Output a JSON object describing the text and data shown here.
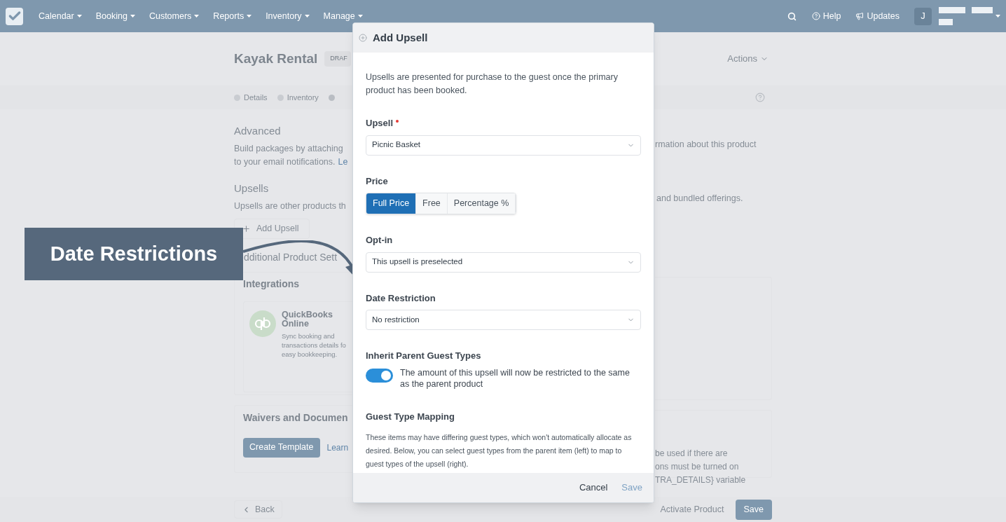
{
  "nav": {
    "items": [
      {
        "label": "Calendar"
      },
      {
        "label": "Booking"
      },
      {
        "label": "Customers"
      },
      {
        "label": "Reports"
      },
      {
        "label": "Inventory"
      },
      {
        "label": "Manage"
      }
    ],
    "help": "Help",
    "updates": "Updates",
    "avatar": "J"
  },
  "page": {
    "title": "Kayak Rental",
    "badge": "DRAF",
    "actions": "Actions",
    "steps": [
      {
        "label": "Details"
      },
      {
        "label": "Inventory"
      }
    ]
  },
  "advanced": {
    "heading": "Advanced",
    "text_left": [
      "Build packages by attaching",
      "to your email notifications."
    ],
    "link": "Le",
    "text_right": "rmation about this product"
  },
  "upsells": {
    "heading": "Upsells",
    "text_left": "Upsells are other products th",
    "text_right": "and bundled offerings.",
    "add_button": "Add Upsell"
  },
  "additional_heading": "dditional Product Sett",
  "integrations": {
    "title": "Integrations",
    "app_name": "QuickBooks Online",
    "app_description": [
      "Sync booking and",
      "transactions details fo",
      "easy bookkeeping."
    ]
  },
  "waivers": {
    "title": "Waivers and Documen",
    "button": "Create Template",
    "link": "Learn",
    "note_lines": [
      "be used if there are",
      "ons must be turned on",
      "TRA_DETAILS} variable"
    ]
  },
  "footer": {
    "back": "Back",
    "activate": "Activate Product",
    "save": "Save"
  },
  "callout": "Date Restrictions",
  "modal": {
    "title": "Add Upsell",
    "description": "Upsells are presented for purchase to the guest once the primary product has been booked.",
    "upsell": {
      "label": "Upsell",
      "required": true,
      "value": "Picnic Basket"
    },
    "price": {
      "label": "Price",
      "options": [
        {
          "label": "Full Price",
          "selected": true
        },
        {
          "label": "Free",
          "selected": false
        },
        {
          "label": "Percentage %",
          "selected": false
        }
      ]
    },
    "opt_in": {
      "label": "Opt-in",
      "value": "This upsell is preselected"
    },
    "date_restriction": {
      "label": "Date Restriction",
      "value": "No restriction"
    },
    "inherit": {
      "label": "Inherit Parent Guest Types",
      "on": true,
      "text": "The amount of this upsell will now be restricted to the same as the parent product"
    },
    "mapping": {
      "title": "Guest Type Mapping",
      "text": "These items may have differing guest types, which won't automatically allocate as desired. Below, you can select guest types from the parent item (left) to map to guest types of the upsell (right)."
    },
    "cancel": "Cancel",
    "save": {
      "label": "Save",
      "disabled": true
    }
  }
}
